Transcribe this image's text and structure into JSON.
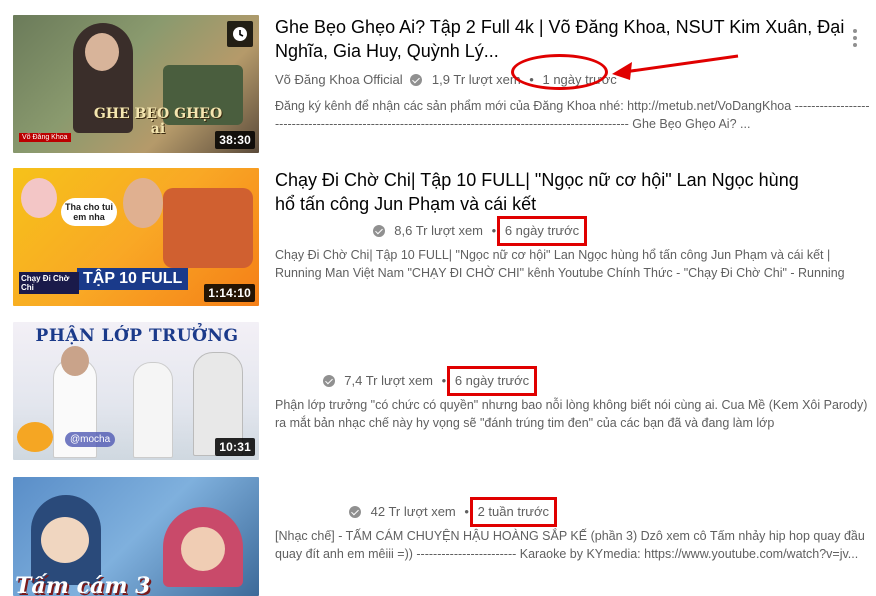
{
  "videos": [
    {
      "title": "Ghe Bẹo Ghẹo Ai? Tập 2 Full 4k | Võ Đăng Khoa, NSUT Kim Xuân, Đại Nghĩa, Gia Huy, Quỳnh Lý...",
      "channel": "Võ Đăng Khoa Official",
      "views": "1,9 Tr lượt xem",
      "age": "1 ngày trước",
      "desc": "Đăng ký kênh để nhận các sản phẩm mới của Đăng Khoa nhé: http://metub.net/VoDangKhoa ------------------------------------------------------------------------------------------------------- Ghe Bẹo Ghẹo Ai? ...",
      "duration": "38:30",
      "thumb_text": "GHE BẸO GHẸO ai",
      "thumb_small": "Võ Đăng Khoa"
    },
    {
      "title": "Chạy Đi Chờ Chi| Tập 10 FULL| \"Ngọc nữ cơ hội\" Lan Ngọc hùng hổ tấn công Jun Phạm và cái kết",
      "channel": "",
      "views": "8,6 Tr lượt xem",
      "age": "6 ngày trước",
      "desc": "Chạy Đi Chờ Chi| Tập 10 FULL| \"Ngọc nữ cơ hội\" Lan Ngọc hùng hổ tấn công Jun Phạm và cái kết | Running Man Việt Nam \"CHẠY ĐI CHỜ CHI\" kênh Youtube Chính Thức - \"Chạy Đi Chờ Chi\" - Running Man",
      "duration": "1:14:10",
      "thumb_text": "TẬP 10 FULL",
      "thumb_small": "Tha cho tui em nha",
      "thumb_logo": "Chạy Đi Chờ Chi"
    },
    {
      "title": "",
      "channel": "",
      "views": "7,4 Tr lượt xem",
      "age": "6 ngày trước",
      "desc": "Phận lớp trưởng \"có chức có quyền\" nhưng bao nỗi lòng không biết nói cùng ai. Cua Mề (Kem Xôi Parody) ra mắt bản nhạc chế này hy vọng sẽ \"đánh trúng tim đen\" của các bạn đã và đang làm lớp",
      "duration": "10:31",
      "thumb_text": "PHẬN LỚP TRƯỞNG",
      "thumb_small": "@mocha"
    },
    {
      "title": "",
      "channel": "",
      "views": "42 Tr lượt xem",
      "age": "2 tuần trước",
      "desc": "[Nhạc chế] - TẤM CÁM CHUYỆN HẬU HOÀNG SẮP KẾ (phần 3) Dzô xem cô Tấm nhảy hip hop quay đầu quay đít anh em mêiii =)) ------------------------ Karaoke by KYmedia: https://www.youtube.com/watch?v=jv...",
      "duration": "",
      "thumb_text": "Tấm cám 3"
    }
  ],
  "colors": {
    "annotation": "#e00000",
    "meta": "#606060"
  },
  "icons": [
    "watch-later-clock-icon",
    "verified-check-icon",
    "more-vert-icon"
  ]
}
